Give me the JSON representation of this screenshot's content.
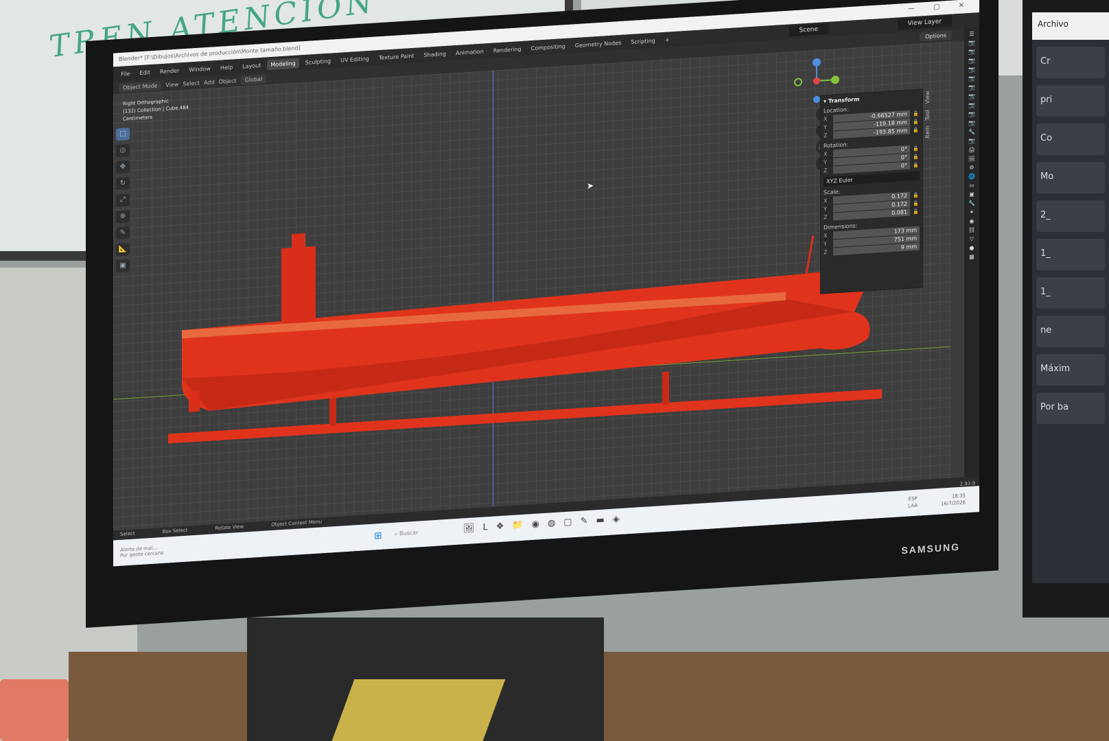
{
  "background": {
    "whiteboard_text": "TREN ATENCIÓN"
  },
  "right_monitor": {
    "title": "Archivo",
    "items": [
      "Cr",
      "pri",
      "Co",
      "Mo",
      "2_",
      "1_",
      "1_",
      "ne",
      "Máxim",
      "Por ba"
    ]
  },
  "monitor": {
    "brand": "SAMSUNG"
  },
  "blender": {
    "title": "Blender* [F:\\Dibujos\\Archivos de producción\\Monte tamaño.blend]",
    "menu": [
      "File",
      "Edit",
      "Render",
      "Window",
      "Help"
    ],
    "workspaces": [
      "Layout",
      "Modeling",
      "Sculpting",
      "UV Editing",
      "Texture Paint",
      "Shading",
      "Animation",
      "Rendering",
      "Compositing",
      "Geometry Nodes",
      "Scripting"
    ],
    "active_workspace": "Modeling",
    "scene": "Scene",
    "view_layer": "View Layer",
    "header": {
      "mode": "Object Mode",
      "menus": [
        "View",
        "Select",
        "Add",
        "Object"
      ],
      "orientation": "Global",
      "options": "Options"
    },
    "viewport_info": [
      "Right Orthographic",
      "(132) Collection | Cube.484",
      "Centimeters"
    ],
    "side_tabs": [
      "Item",
      "Tool",
      "View"
    ],
    "transform": {
      "title": "Transform",
      "location_label": "Location:",
      "location": {
        "X": "-0.66527 mm",
        "Y": "-119.18 mm",
        "Z": "-193.85 mm"
      },
      "rotation_label": "Rotation:",
      "rotation": {
        "X": "0°",
        "Y": "0°",
        "Z": "0°"
      },
      "rotation_mode": "XYZ Euler",
      "scale_label": "Scale:",
      "scale": {
        "X": "0.172",
        "Y": "0.172",
        "Z": "0.081"
      },
      "dimensions_label": "Dimensions:",
      "dimensions": {
        "X": "173 mm",
        "Y": "751 mm",
        "Z": "9 mm"
      }
    },
    "status": {
      "select": "Select",
      "box_select": "Box Select",
      "rotate": "Rotate View",
      "context": "Object Context Menu"
    },
    "version": "2.93.9",
    "ship_color": "#e0331c",
    "axis_colors": {
      "x": "#e04646",
      "y": "#84c23c",
      "z": "#4a8fe0"
    }
  },
  "taskbar": {
    "weather": [
      "Alerta de mal...",
      "Por gente cercana"
    ],
    "search": "Buscar",
    "lang": [
      "ESP",
      "LAA"
    ],
    "time": "18:35",
    "date": "16/7/2026"
  }
}
